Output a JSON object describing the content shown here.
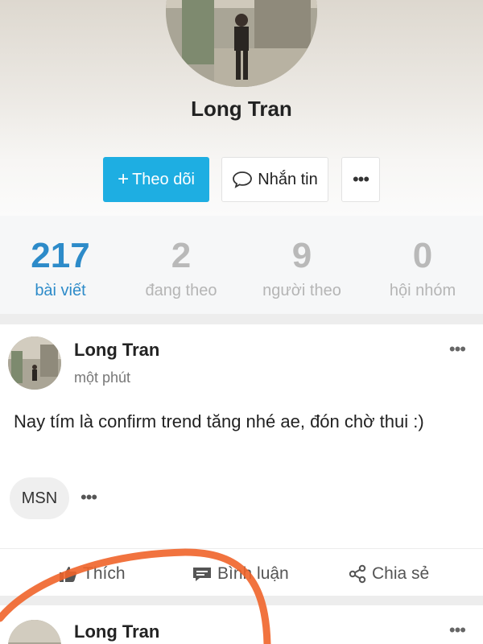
{
  "profile": {
    "name": "Long Tran",
    "follow_button": "Theo dõi",
    "follow_plus_icon": "plus-icon",
    "message_button": "Nhắn tin",
    "message_icon": "chat-bubble-icon",
    "more_button": "•••"
  },
  "stats": [
    {
      "value": "217",
      "label": "bài viết",
      "active": true
    },
    {
      "value": "2",
      "label": "đang theo",
      "active": false
    },
    {
      "value": "9",
      "label": "người theo",
      "active": false
    },
    {
      "value": "0",
      "label": "hội nhóm",
      "active": false
    }
  ],
  "post": {
    "author": "Long Tran",
    "time": "một phút",
    "options": "•••",
    "text": "Nay tím là confirm trend tăng nhé ae, đón chờ thui :)",
    "tag": "MSN",
    "tag_more": "•••",
    "actions": {
      "like": "Thích",
      "comment": "Bình luận",
      "share": "Chia sẻ"
    }
  },
  "post2": {
    "author": "Long Tran",
    "options": "•••"
  },
  "colors": {
    "accent": "#1eaee2",
    "stat_active": "#2d8bc9",
    "annotation_stroke": "#f0642a"
  }
}
